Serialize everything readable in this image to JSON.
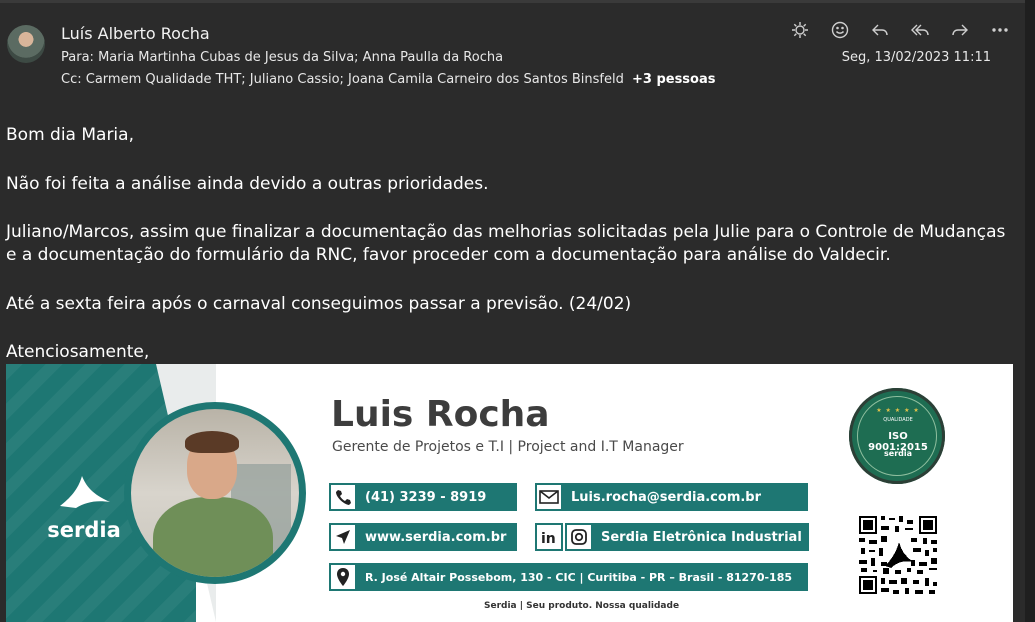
{
  "email": {
    "sender": "Luís Alberto Rocha",
    "to_label": "Para:",
    "to": "Maria Martinha Cubas de Jesus da Silva;  Anna Paulla da Rocha",
    "cc_label": "Cc:",
    "cc": "Carmem Qualidade THT;  Juliano Cassio;  Joana Camila Carneiro dos Santos Binsfeld",
    "cc_more": "+3 pessoas",
    "date": "Seg, 13/02/2023 11:11"
  },
  "toolbar": {
    "icons": [
      "sun-icon",
      "smiley-icon",
      "reply-icon",
      "reply-all-icon",
      "forward-icon",
      "more-icon"
    ]
  },
  "body": {
    "greeting": "Bom dia Maria,",
    "p1": "Não foi feita a análise ainda devido a outras prioridades.",
    "p2": "Juliano/Marcos, assim que finalizar a documentação das melhorias solicitadas pela Julie para o Controle de Mudanças e a documentação do formulário da RNC, favor proceder com a documentação para análise do Valdecir.",
    "p3": "Até a sexta feira após o carnaval conseguimos passar a previsão. (24/02)",
    "closing": "Atenciosamente,"
  },
  "signature": {
    "logo_text": "serdia",
    "name": "Luis Rocha",
    "title": "Gerente de Projetos e T.I | Project and I.T Manager",
    "phone": "(41) 3239 - 8919",
    "email": "Luis.rocha@serdia.com.br",
    "website": "www.serdia.com.br",
    "social": "Serdia Eletrônica Industrial",
    "address": "R. José Altair Possebom, 130 - CIC | Curitiba - PR – Brasil - 81270-185",
    "iso_label": "QUALIDADE",
    "iso_text": "ISO 9001:2015",
    "iso_brand": "serdia",
    "footer": "Serdia | Seu produto. Nossa qualidade",
    "accent": "#1e7773"
  }
}
